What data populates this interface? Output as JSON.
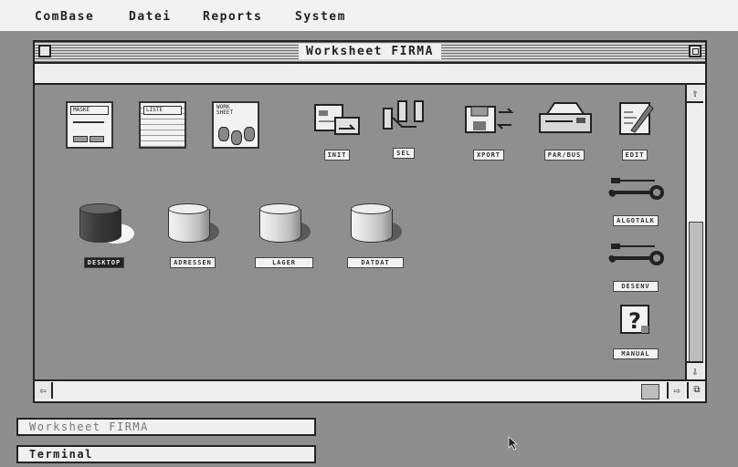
{
  "menubar": {
    "items": [
      "ComBase",
      "Datei",
      "Reports",
      "System"
    ]
  },
  "window": {
    "title": "Worksheet FIRMA",
    "icons_row1": [
      {
        "name": "maske",
        "label": "MASKE"
      },
      {
        "name": "liste",
        "label": "LISTE"
      },
      {
        "name": "worksheet",
        "label": "WORK SHEET"
      }
    ],
    "tools": [
      {
        "name": "init",
        "label": "INIT"
      },
      {
        "name": "sel",
        "label": "SEL"
      },
      {
        "name": "xport",
        "label": "XPORT"
      },
      {
        "name": "par-bus",
        "label": "PAR/BUS"
      },
      {
        "name": "edit",
        "label": "EDIT"
      }
    ],
    "databases": [
      {
        "name": "desktop",
        "label": "DESKTOP",
        "selected": true
      },
      {
        "name": "adressen",
        "label": "ADRESSEN",
        "selected": false
      },
      {
        "name": "lager",
        "label": "LAGER",
        "selected": false
      },
      {
        "name": "datdat",
        "label": "DATDAT",
        "selected": false
      }
    ],
    "right_tools": [
      {
        "name": "algotalk",
        "label": "ALGOTALK"
      },
      {
        "name": "desenv",
        "label": "DESENV"
      },
      {
        "name": "manual",
        "label": "MANUAL"
      }
    ]
  },
  "taskbars": [
    "Worksheet FIRMA",
    "Terminal"
  ]
}
